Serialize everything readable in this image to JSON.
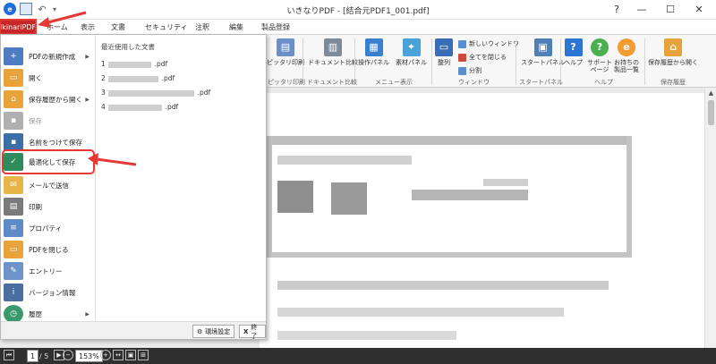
{
  "window": {
    "title": "いきなりPDF - [結合元PDF1_001.pdf]",
    "help": "?",
    "minimize": "—",
    "maximize": "☐",
    "close": "✕"
  },
  "file_tab": "IkinariPDF",
  "tabs": [
    "ホーム",
    "表示",
    "文書",
    "セキュリティ",
    "注釈",
    "編集",
    "製品登録"
  ],
  "ribbon": {
    "buttons": {
      "fit_print": "ピッタリ印刷",
      "doc_compare": "ドキュメント比較",
      "ops_panel": "操作パネル",
      "material_panel": "素材パネル",
      "arrange": "整列",
      "new_window": "新しいウィンドウ",
      "close_all": "全てを閉じる",
      "split": "分割",
      "start_panel": "スタートパネル",
      "help": "ヘルプ",
      "support_page": "サポート\nページ",
      "products_list": "お持ちの\n製品一覧",
      "open_from_history": "保存履歴から開く"
    },
    "groups": {
      "fit_print": "ピッタリ印刷",
      "doc_compare": "ドキュメント比較",
      "menu_display": "メニュー表示",
      "window": "ウィンドウ",
      "start_panel": "スタートパネル",
      "help": "ヘルプ",
      "save_history": "保存履歴"
    }
  },
  "file_menu": {
    "items": {
      "new_pdf": "PDFの新規作成",
      "open": "開く",
      "open_from_history": "保存履歴から開く",
      "save": "保存",
      "save_as": "名前をつけて保存",
      "optimize_save": "最適化して保存",
      "send_mail": "メールで送信",
      "print": "印刷",
      "properties": "プロパティ",
      "close_pdf": "PDFを閉じる",
      "entry": "エントリー",
      "version_info": "バージョン情報",
      "history": "履歴"
    },
    "recent_title": "最近使用した文書",
    "recent": [
      {
        "num": "1",
        "ext": ".pdf"
      },
      {
        "num": "2",
        "ext": ".pdf"
      },
      {
        "num": "3",
        "ext": ".pdf"
      },
      {
        "num": "4",
        "ext": ".pdf"
      }
    ],
    "settings_button": "環境設定",
    "exit_button": "終了"
  },
  "statusbar": {
    "current_page": "1",
    "page_sep": "/ 5",
    "zoom": "153%"
  },
  "colors": {
    "accent_red": "#e53935",
    "file_tab_bg": "#c62828"
  }
}
